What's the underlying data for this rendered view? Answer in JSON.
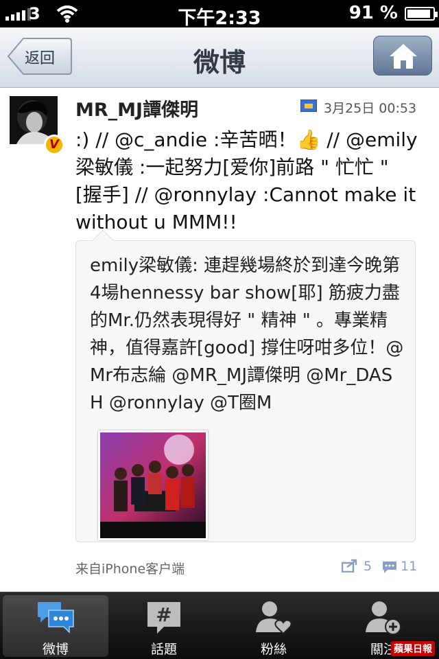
{
  "status_bar": {
    "carrier": "3",
    "time": "下午2:33",
    "battery": "91 %",
    "battery_level": 0.91,
    "icons": [
      "signal-icon",
      "wifi-icon",
      "battery-icon"
    ]
  },
  "nav": {
    "back_label": "返回",
    "title": "微博",
    "home_icon": "home-icon"
  },
  "post": {
    "author": "MR_MJ譚傑明",
    "time": "3月25日 00:53",
    "text": ":) // @c_andie :辛苦晒！👍 // @emily梁敏儀 :一起努力[爱你]前路 \" 忙忙 \" [握手] // @ronnylay :Cannot make it without u MMM!!",
    "quote": {
      "text": "emily梁敏儀: 連趕幾場終於到達今晚第4場hennessy bar show[耶] 筋疲力盡的Mr.仍然表現得好 \" 精神 \" 。專業精神，值得嘉許[good] 撐住呀咁多位！@Mr布志綸 @MR_MJ譚傑明 @Mr_DASH @ronnylay @T圈M"
    },
    "source": "来自iPhone客户端",
    "retweets": "5",
    "comments": "11"
  },
  "tabs": [
    {
      "label": "微博",
      "icon": "weibo-chat-icon",
      "active": true
    },
    {
      "label": "話題",
      "icon": "hashtag-icon",
      "active": false
    },
    {
      "label": "粉絲",
      "icon": "fans-heart-icon",
      "active": false
    },
    {
      "label": "關注",
      "icon": "add-follow-icon",
      "active": false
    }
  ],
  "watermark": "蘋果日報",
  "colors": {
    "tab_bar": "#111111",
    "nav_bar": "#d6dde6",
    "home_button": "#6f86a6",
    "verified": "#f5b400"
  }
}
